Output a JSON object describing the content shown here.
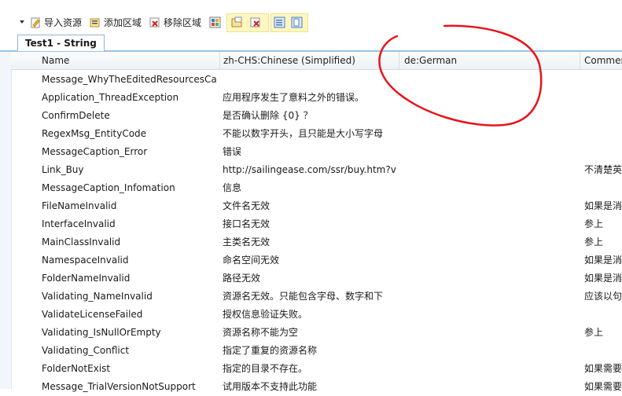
{
  "toolbar": {
    "import_label": "导入资源",
    "add_region_label": "添加区域",
    "remove_region_label": "移除区域"
  },
  "tab": {
    "label": "Test1 - String"
  },
  "columns": [
    "Name",
    "zh-CHS:Chinese (Simplified)",
    "de:German",
    "Commen"
  ],
  "rows": [
    {
      "name": "Message_WhyTheEditedResourcesCa",
      "zh": "",
      "de": "",
      "comment": ""
    },
    {
      "name": "Application_ThreadException",
      "zh": "应用程序发生了意料之外的错误。",
      "de": "",
      "comment": ""
    },
    {
      "name": "ConfirmDelete",
      "zh": "是否确认删除 {0} ？",
      "de": "",
      "comment": ""
    },
    {
      "name": "RegexMsg_EntityCode",
      "zh": "不能以数字开头，且只能是大小写字母",
      "de": "",
      "comment": ""
    },
    {
      "name": "MessageCaption_Error",
      "zh": "错误",
      "de": "",
      "comment": ""
    },
    {
      "name": "Link_Buy",
      "zh": "http://sailingease.com/ssr/buy.htm?v",
      "de": "",
      "comment": "不清楚英"
    },
    {
      "name": "MessageCaption_Infomation",
      "zh": "信息",
      "de": "",
      "comment": ""
    },
    {
      "name": "FileNameInvalid",
      "zh": "文件名无效",
      "de": "",
      "comment": "如果是消"
    },
    {
      "name": "InterfaceInvalid",
      "zh": "接口名无效",
      "de": "",
      "comment": "参上"
    },
    {
      "name": "MainClassInvalid",
      "zh": "主类名无效",
      "de": "",
      "comment": "参上"
    },
    {
      "name": "NamespaceInvalid",
      "zh": "命名空间无效",
      "de": "",
      "comment": "如果是消"
    },
    {
      "name": "FolderNameInvalid",
      "zh": "路径无效",
      "de": "",
      "comment": "如果是消"
    },
    {
      "name": "Validating_NameInvalid",
      "zh": "资源名无效。只能包含字母、数字和下",
      "de": "",
      "comment": "应该以句"
    },
    {
      "name": "ValidateLicenseFailed",
      "zh": "授权信息验证失败。",
      "de": "",
      "comment": ""
    },
    {
      "name": "Validating_IsNullOrEmpty",
      "zh": "资源名称不能为空",
      "de": "",
      "comment": "参上"
    },
    {
      "name": "Validating_Conflict",
      "zh": "指定了重复的资源名称",
      "de": "",
      "comment": ""
    },
    {
      "name": "FolderNotExist",
      "zh": "指定的目录不存在。",
      "de": "",
      "comment": "如果需要"
    },
    {
      "name": "Message_TrialVersionNotSupport",
      "zh": "试用版本不支持此功能",
      "de": "",
      "comment": "如果需要"
    }
  ],
  "colors": {
    "annotation": "#e8141b",
    "header_border": "#d6dde5",
    "tab_accent": "#9bc2e6",
    "highlight_group": "#fff7c2"
  }
}
